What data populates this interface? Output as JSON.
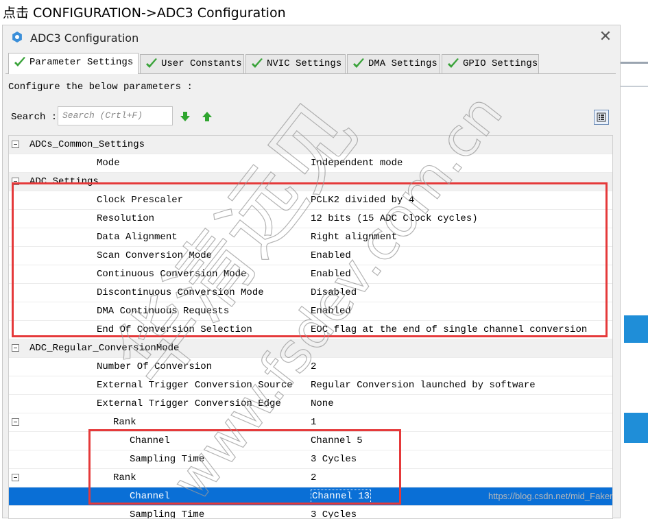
{
  "caption": "点击 CONFIGURATION->ADC3 Configuration",
  "window": {
    "title": "ADC3 Configuration",
    "close_icon": "close-icon"
  },
  "tabs": [
    {
      "label": "Parameter Settings",
      "active": true
    },
    {
      "label": "User Constants",
      "active": false
    },
    {
      "label": "NVIC Settings",
      "active": false
    },
    {
      "label": "DMA Settings",
      "active": false
    },
    {
      "label": "GPIO Settings",
      "active": false
    }
  ],
  "config_label": "Configure the below parameters :",
  "search": {
    "label": "Search :",
    "placeholder": "Search (Crtl+F)"
  },
  "rows": [
    {
      "name": "ADCs_Common_Settings",
      "value": "",
      "level": 0,
      "group": true
    },
    {
      "name": "Mode",
      "value": "Independent mode",
      "level": 1
    },
    {
      "name": "ADC Settings",
      "value": "",
      "level": 0,
      "group": true
    },
    {
      "name": "Clock Prescaler",
      "value": "PCLK2 divided by 4",
      "level": 1
    },
    {
      "name": "Resolution",
      "value": "12 bits (15 ADC Clock cycles)",
      "level": 1
    },
    {
      "name": "Data Alignment",
      "value": "Right alignment",
      "level": 1
    },
    {
      "name": "Scan Conversion Mode",
      "value": "Enabled",
      "level": 1
    },
    {
      "name": "Continuous Conversion Mode",
      "value": "Enabled",
      "level": 1
    },
    {
      "name": "Discontinuous Conversion Mode",
      "value": "Disabled",
      "level": 1
    },
    {
      "name": "DMA Continuous Requests",
      "value": "Enabled",
      "level": 1
    },
    {
      "name": "End Of Conversion Selection",
      "value": "EOC flag at the end of single channel conversion",
      "level": 1
    },
    {
      "name": "ADC_Regular_ConversionMode",
      "value": "",
      "level": 0,
      "group": true
    },
    {
      "name": "Number Of Conversion",
      "value": "2",
      "level": 1
    },
    {
      "name": "External Trigger Conversion Source",
      "value": "Regular Conversion launched by software",
      "level": 1
    },
    {
      "name": "External Trigger Conversion Edge",
      "value": "None",
      "level": 1
    },
    {
      "name": "Rank",
      "value": "1",
      "level": 2,
      "toggle": true
    },
    {
      "name": "Channel",
      "value": "Channel 5",
      "level": 3
    },
    {
      "name": "Sampling Time",
      "value": "3 Cycles",
      "level": 3
    },
    {
      "name": "Rank",
      "value": "2",
      "level": 2,
      "toggle": true
    },
    {
      "name": "Channel",
      "value": "Channel 13",
      "level": 3,
      "selected": true
    },
    {
      "name": "Sampling Time",
      "value": "3 Cycles",
      "level": 3
    }
  ],
  "watermark": {
    "line1": "华清远见",
    "line2": "www.fsdev.com.cn"
  },
  "credit": "https://blog.csdn.net/mid_Faker",
  "colors": {
    "highlight": "#e5393a",
    "selection": "#0a6fd6",
    "check": "#3aa33a"
  }
}
